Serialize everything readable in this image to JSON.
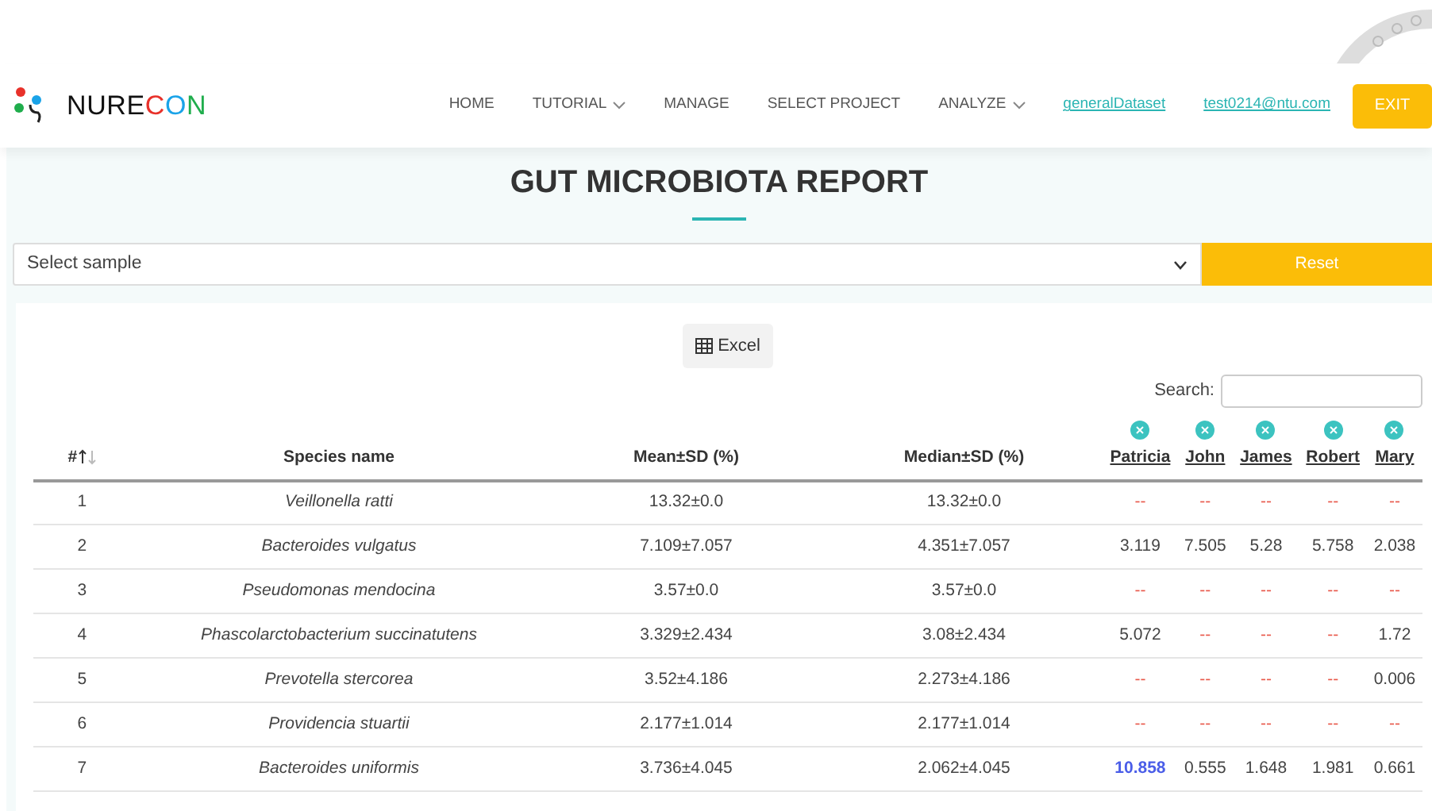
{
  "brand": {
    "name_parts": [
      {
        "text": "NURE",
        "color": "#111111"
      },
      {
        "text": "C",
        "color": "#e8312a"
      },
      {
        "text": "O",
        "color": "#1aa3e8"
      },
      {
        "text": "N",
        "color": "#1fad4c"
      }
    ]
  },
  "nav": [
    {
      "label": "HOME",
      "kind": "plain"
    },
    {
      "label": "TUTORIAL",
      "kind": "dropdown"
    },
    {
      "label": "MANAGE",
      "kind": "plain"
    },
    {
      "label": "SELECT PROJECT",
      "kind": "plain"
    },
    {
      "label": "ANALYZE",
      "kind": "dropdown"
    },
    {
      "label": "generalDataset",
      "kind": "link"
    },
    {
      "label": "test0214@ntu.com",
      "kind": "link"
    },
    {
      "label": "EXIT",
      "kind": "button"
    }
  ],
  "title": "GUT MICROBIOTA REPORT",
  "sample_select": {
    "value": "Select sample"
  },
  "reset_button": "Reset",
  "excel_button": "Excel",
  "search": {
    "label": "Search:"
  },
  "table": {
    "columns": [
      {
        "label": "#",
        "sortable": true
      },
      {
        "label": "Species name",
        "sortable": false
      },
      {
        "label": "Mean±SD (%)",
        "sortable": false
      },
      {
        "label": "Median±SD (%)",
        "sortable": false
      }
    ],
    "samples": [
      {
        "label": "Patricia",
        "removable": true
      },
      {
        "label": "John",
        "removable": true
      },
      {
        "label": "James",
        "removable": true
      },
      {
        "label": "Robert",
        "removable": true
      },
      {
        "label": "Mary",
        "removable": true
      }
    ],
    "rows": [
      {
        "index": "1",
        "species": "Veillonella ratti",
        "mean": "13.32±0.0",
        "median": "13.32±0.0",
        "values": [
          {
            "text": "--",
            "kind": "missing"
          },
          {
            "text": "--",
            "kind": "missing"
          },
          {
            "text": "--",
            "kind": "missing"
          },
          {
            "text": "--",
            "kind": "missing"
          },
          {
            "text": "--",
            "kind": "missing"
          }
        ]
      },
      {
        "index": "2",
        "species": "Bacteroides vulgatus",
        "mean": "7.109±7.057",
        "median": "4.351±7.057",
        "values": [
          {
            "text": "3.119",
            "kind": "value"
          },
          {
            "text": "7.505",
            "kind": "value"
          },
          {
            "text": "5.28",
            "kind": "value"
          },
          {
            "text": "5.758",
            "kind": "value"
          },
          {
            "text": "2.038",
            "kind": "value"
          }
        ]
      },
      {
        "index": "3",
        "species": "Pseudomonas mendocina",
        "mean": "3.57±0.0",
        "median": "3.57±0.0",
        "values": [
          {
            "text": "--",
            "kind": "missing"
          },
          {
            "text": "--",
            "kind": "missing"
          },
          {
            "text": "--",
            "kind": "missing"
          },
          {
            "text": "--",
            "kind": "missing"
          },
          {
            "text": "--",
            "kind": "missing"
          }
        ]
      },
      {
        "index": "4",
        "species": "Phascolarctobacterium succinatutens",
        "mean": "3.329±2.434",
        "median": "3.08±2.434",
        "values": [
          {
            "text": "5.072",
            "kind": "value"
          },
          {
            "text": "--",
            "kind": "missing"
          },
          {
            "text": "--",
            "kind": "missing"
          },
          {
            "text": "--",
            "kind": "missing"
          },
          {
            "text": "1.72",
            "kind": "value"
          }
        ]
      },
      {
        "index": "5",
        "species": "Prevotella stercorea",
        "mean": "3.52±4.186",
        "median": "2.273±4.186",
        "values": [
          {
            "text": "--",
            "kind": "missing"
          },
          {
            "text": "--",
            "kind": "missing"
          },
          {
            "text": "--",
            "kind": "missing"
          },
          {
            "text": "--",
            "kind": "missing"
          },
          {
            "text": "0.006",
            "kind": "value"
          }
        ]
      },
      {
        "index": "6",
        "species": "Providencia stuartii",
        "mean": "2.177±1.014",
        "median": "2.177±1.014",
        "values": [
          {
            "text": "--",
            "kind": "missing"
          },
          {
            "text": "--",
            "kind": "missing"
          },
          {
            "text": "--",
            "kind": "missing"
          },
          {
            "text": "--",
            "kind": "missing"
          },
          {
            "text": "--",
            "kind": "missing"
          }
        ]
      },
      {
        "index": "7",
        "species": "Bacteroides uniformis",
        "mean": "3.736±4.045",
        "median": "2.062±4.045",
        "values": [
          {
            "text": "10.858",
            "kind": "highlight"
          },
          {
            "text": "0.555",
            "kind": "value"
          },
          {
            "text": "1.648",
            "kind": "value"
          },
          {
            "text": "1.981",
            "kind": "value"
          },
          {
            "text": "0.661",
            "kind": "value"
          }
        ]
      }
    ]
  }
}
